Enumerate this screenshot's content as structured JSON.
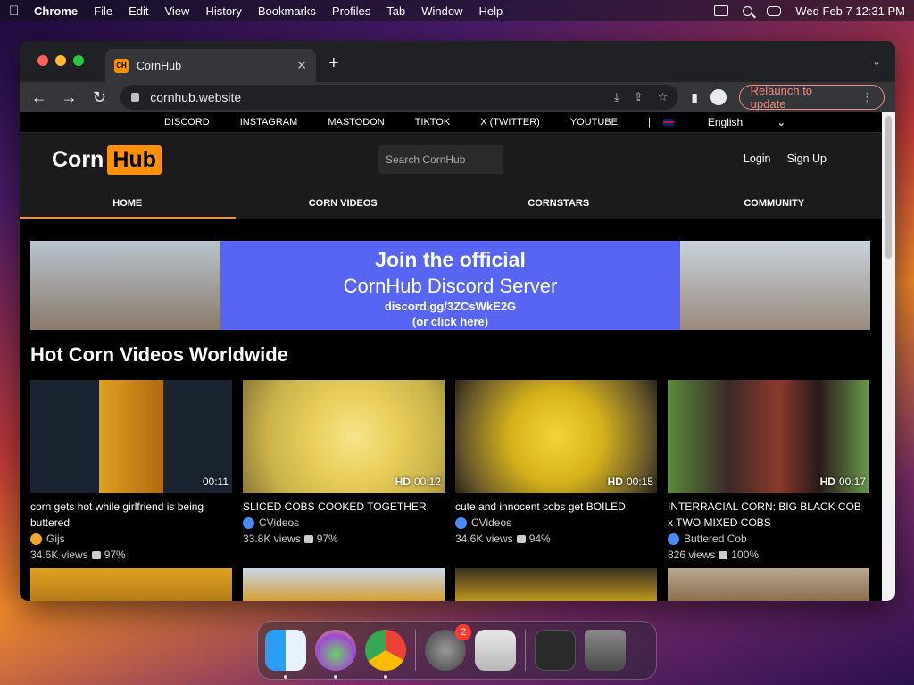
{
  "menubar": {
    "app": "Chrome",
    "items": [
      "File",
      "Edit",
      "View",
      "History",
      "Bookmarks",
      "Profiles",
      "Tab",
      "Window",
      "Help"
    ],
    "datetime": "Wed Feb 7  12:31 PM"
  },
  "browser": {
    "tab_title": "CornHub",
    "favicon_text": "CH",
    "url": "cornhub.website",
    "relaunch_label": "Relaunch to update"
  },
  "site": {
    "social_links": [
      "DISCORD",
      "INSTAGRAM",
      "MASTODON",
      "TIKTOK",
      "X (TWITTER)",
      "YOUTUBE"
    ],
    "separator": "|",
    "language": "English",
    "logo_left": "Corn",
    "logo_right": "Hub",
    "search_placeholder": "Search CornHub",
    "login": "Login",
    "signup": "Sign Up",
    "nav": [
      "HOME",
      "CORN VIDEOS",
      "CORNSTARS",
      "COMMUNITY"
    ],
    "banner": {
      "line1": "Join the official",
      "line2": "CornHub Discord Server",
      "line3": "discord.gg/3ZCsWkE2G",
      "line4": "(or click here)"
    },
    "section_title": "Hot Corn Videos Worldwide",
    "videos": [
      {
        "title": "corn gets hot while girlfriend is being buttered",
        "author": "Gijs",
        "verified": "gold",
        "hd": "",
        "duration": "00:11",
        "views": "34.6K views",
        "rating": "97%",
        "thumb_bg": "linear-gradient(90deg,#1a2430 0,#1a2430 34%,#e0a020 34%,#b06a10 66%,#1a2430 66%)"
      },
      {
        "title": "SLICED COBS COOKED TOGETHER",
        "author": "CVideos",
        "verified": "blue",
        "hd": "HD",
        "duration": "00:12",
        "views": "33.8K views",
        "rating": "97%",
        "thumb_bg": "radial-gradient(circle at 55% 50%,#f6e48a 0,#e8cf5a 35%,#c9b24a 70%,#8c7a38 100%)"
      },
      {
        "title": "cute and innocent cobs get BOILED",
        "author": "CVideos",
        "verified": "blue",
        "hd": "HD",
        "duration": "00:15",
        "views": "34.6K views",
        "rating": "94%",
        "thumb_bg": "radial-gradient(circle at 50% 50%,#f2d438 0,#d6b21a 40%,#6a5a2a 80%,#2a2418 100%)"
      },
      {
        "title": "INTERRACIAL CORN: BIG BLACK COB x TWO MIXED COBS",
        "author": "Buttered Cob",
        "verified": "blue",
        "hd": "HD",
        "duration": "00:17",
        "views": "826 views",
        "rating": "100%",
        "thumb_bg": "linear-gradient(90deg,#5a8a3a 0,#3a2a2a 30%,#8a3a2a 55%,#2a1a1a 75%,#6a9a4a 100%)"
      }
    ],
    "row2_thumbs": [
      "linear-gradient(180deg,#e0a020,#b07a18)",
      "linear-gradient(180deg,#c8d8e8,#d89a28)",
      "linear-gradient(180deg,#3a3020,#c9a020)",
      "linear-gradient(180deg,#b8a890,#8a6a4a)"
    ]
  },
  "dock": {
    "badge": "2"
  }
}
